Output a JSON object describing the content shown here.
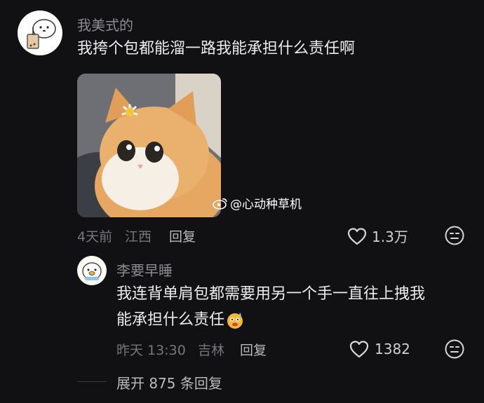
{
  "comment": {
    "username": "我美式的",
    "text": "我挎个包都能溜一路我能承担什么责任啊",
    "image_watermark": "@心动种草机",
    "time": "4天前",
    "location": "江西",
    "reply_label": "回复",
    "likes": "1.3万"
  },
  "reply": {
    "username": "李要早睡",
    "text_line1": "我连背单肩包都需要用另一个手一直往上拽我",
    "text_line2": "能承担什么责任",
    "time": "昨天 13:30",
    "location": "吉林",
    "reply_label": "回复",
    "likes": "1382"
  },
  "expand": {
    "label": "展开 875 条回复"
  }
}
